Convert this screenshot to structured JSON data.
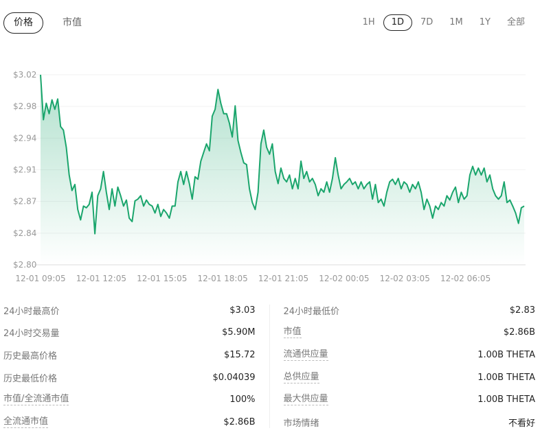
{
  "tabs": [
    {
      "label": "价格",
      "active": true
    },
    {
      "label": "市值",
      "active": false
    }
  ],
  "ranges": [
    {
      "label": "1H"
    },
    {
      "label": "1D",
      "active": true
    },
    {
      "label": "7D"
    },
    {
      "label": "1M"
    },
    {
      "label": "1Y"
    },
    {
      "label": "全部"
    }
  ],
  "chart_data": {
    "type": "area",
    "title": "",
    "color": "#1aa56c",
    "ylim": [
      2.8,
      3.02
    ],
    "y_ticks": [
      "$3.02",
      "$2.98",
      "$2.94",
      "$2.91",
      "$2.87",
      "$2.84",
      "$2.80"
    ],
    "x_ticks": [
      "12-01 09:05",
      "12-01 12:05",
      "12-01 15:05",
      "12-01 18:05",
      "12-01 21:05",
      "12-02 00:05",
      "12-02 03:05",
      "12-02 06:05"
    ],
    "x_span_hours": 23.9,
    "values": [
      3.02,
      2.968,
      2.987,
      2.975,
      2.991,
      2.98,
      2.992,
      2.96,
      2.956,
      2.936,
      2.904,
      2.886,
      2.893,
      2.864,
      2.852,
      2.868,
      2.866,
      2.87,
      2.884,
      2.836,
      2.88,
      2.888,
      2.908,
      2.884,
      2.864,
      2.888,
      2.868,
      2.89,
      2.88,
      2.868,
      2.875,
      2.854,
      2.85,
      2.874,
      2.876,
      2.88,
      2.868,
      2.875,
      2.87,
      2.868,
      2.86,
      2.87,
      2.856,
      2.864,
      2.86,
      2.854,
      2.868,
      2.868,
      2.896,
      2.908,
      2.893,
      2.908,
      2.894,
      2.876,
      2.902,
      2.899,
      2.92,
      2.93,
      2.94,
      2.932,
      2.972,
      2.98,
      3.003,
      2.987,
      2.975,
      2.975,
      2.964,
      2.948,
      2.984,
      2.944,
      2.93,
      2.918,
      2.916,
      2.888,
      2.872,
      2.864,
      2.884,
      2.94,
      2.956,
      2.936,
      2.928,
      2.94,
      2.908,
      2.894,
      2.912,
      2.9,
      2.896,
      2.904,
      2.888,
      2.9,
      2.888,
      2.92,
      2.9,
      2.908,
      2.896,
      2.9,
      2.893,
      2.88,
      2.888,
      2.884,
      2.896,
      2.884,
      2.9,
      2.924,
      2.904,
      2.888,
      2.893,
      2.896,
      2.9,
      2.893,
      2.896,
      2.888,
      2.896,
      2.888,
      2.893,
      2.896,
      2.876,
      2.893,
      2.872,
      2.876,
      2.868,
      2.884,
      2.896,
      2.899,
      2.893,
      2.9,
      2.888,
      2.896,
      2.893,
      2.884,
      2.893,
      2.888,
      2.896,
      2.884,
      2.864,
      2.876,
      2.868,
      2.854,
      2.868,
      2.864,
      2.872,
      2.868,
      2.88,
      2.875,
      2.884,
      2.89,
      2.872,
      2.884,
      2.876,
      2.88,
      2.904,
      2.914,
      2.904,
      2.912,
      2.904,
      2.912,
      2.896,
      2.904,
      2.888,
      2.88,
      2.876,
      2.88,
      2.896,
      2.872,
      2.875,
      2.868,
      2.86,
      2.848,
      2.866,
      2.868
    ]
  },
  "stats": {
    "left": [
      {
        "label": "24小时最高价",
        "value": "$3.03",
        "dashed": false
      },
      {
        "label": "24小时交易量",
        "value": "$5.90M",
        "dashed": false
      },
      {
        "label": "历史最高价格",
        "value": "$15.72",
        "dashed": false
      },
      {
        "label": "历史最低价格",
        "value": "$0.04039",
        "dashed": false
      },
      {
        "label": "市值/全流通市值",
        "value": "100%",
        "dashed": true
      },
      {
        "label": "全流通市值",
        "value": "$2.86B",
        "dashed": true
      }
    ],
    "right": [
      {
        "label": "24小时最低价",
        "value": "$2.83",
        "dashed": false
      },
      {
        "label": "市值",
        "value": "$2.86B",
        "dashed": true
      },
      {
        "label": "流通供应量",
        "value": "1.00B THETA",
        "dashed": true
      },
      {
        "label": "总供应量",
        "value": "1.00B THETA",
        "dashed": true
      },
      {
        "label": "最大供应量",
        "value": "1.00B THETA",
        "dashed": true
      },
      {
        "label": "市场情绪",
        "value": "不看好",
        "dashed": false
      }
    ]
  }
}
